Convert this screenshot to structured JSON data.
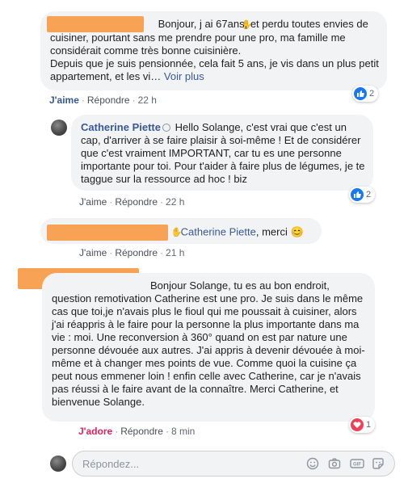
{
  "comments": [
    {
      "text": "Bonjour, j ai 67ans, et perdu toutes envies de cuisiner, pourtant sans me prendre pour une pro, ma famille me considérait comme très bonne cuisinière.\nDepuis que je suis pensionnée, cela fait 5 ans, je vis dans un plus petit appartement, et les vi…",
      "see_more": "Voir plus",
      "actions": {
        "like": "J'aime",
        "reply": "Répondre",
        "time": "22 h"
      },
      "reactions": {
        "count": "2",
        "icon": "like-icon"
      }
    },
    {
      "author": "Catherine Piette",
      "text": "Hello Solange, c'est vrai que c'est un cap, d'arriver à se faire plaisir à soi-même ! Et de considérer que c'est vraiment IMPORTANT, car tu es une personne importante pour toi. Pour t'aider à faire plus de légumes, je te taggue sur la ressource ad hoc ! biz",
      "actions": {
        "like": "J'aime",
        "reply": "Répondre",
        "time": "22 h"
      },
      "reactions": {
        "count": "2",
        "icon": "like-icon"
      }
    },
    {
      "mention": "Catherine Piette",
      "text": ", merci",
      "emoji": "😊",
      "actions": {
        "like": "J'aime",
        "reply": "Répondre",
        "time": "21 h"
      }
    },
    {
      "text": "Bonjour Solange, tu es au bon endroit, question remotivation Catherine est une pro. Je suis dans le même cas que toi,je n'avais plus le fioul qui me poussait à cuisiner, alors j'ai réappris à le faire pour la personne la plus importante dans ma vie : moi. Une reconversion à 360° quand on est par nature une personne dévouée aux autres. J'ai appris à devenir dévouée à moi-même et à changer mes points de vue. Comme quoi la cuisine ça peut nous emmener loin ! enfin celle avec Catherine, car je n'avais pas réussi à le faire avant de la connaître. Merci Catherine, et bienvenue Solange.",
      "actions": {
        "like": "J'adore",
        "reply": "Répondre",
        "time": "8 min"
      },
      "reactions": {
        "count": "1",
        "icon": "heart-icon"
      }
    }
  ],
  "composer": {
    "placeholder": "Répondez...",
    "tools": [
      "emoji-icon",
      "camera-icon",
      "gif-icon",
      "sticker-icon"
    ]
  },
  "colors": {
    "link": "#385898",
    "bubble": "#f2f3f5",
    "redaction": "#f7a254",
    "adore": "#e0245e"
  }
}
